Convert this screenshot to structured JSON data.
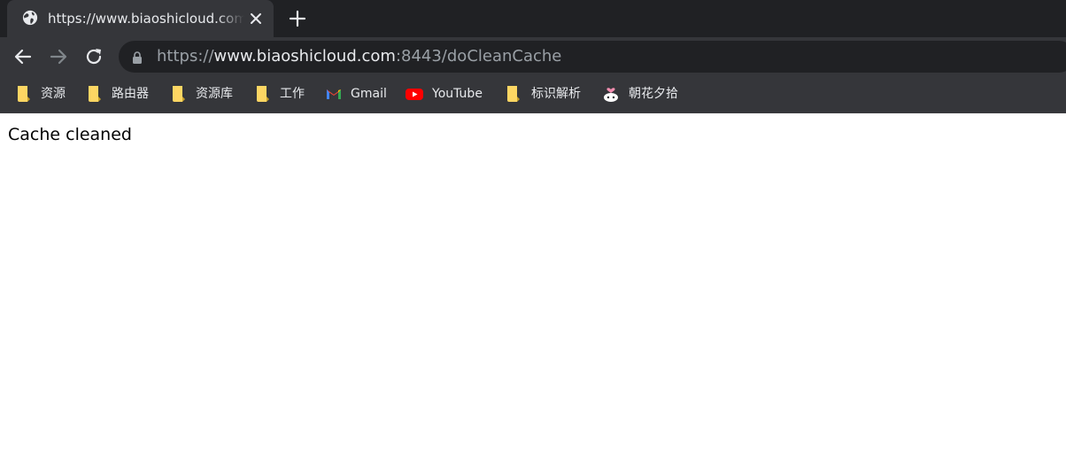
{
  "tab": {
    "title": "https://www.biaoshicloud.com/doCleanCache",
    "favicon_icon": "globe-icon",
    "close_icon": "close-icon"
  },
  "new_tab_icon": "plus-icon",
  "toolbar": {
    "back_icon": "arrow-left-icon",
    "forward_icon": "arrow-right-icon",
    "reload_icon": "reload-icon",
    "lock_icon": "lock-icon"
  },
  "address": {
    "scheme": "https://",
    "host": "www.biaoshicloud.com",
    "rest": ":8443/doCleanCache"
  },
  "bookmarks": [
    {
      "label": "资源",
      "icon": "folder-icon"
    },
    {
      "label": "路由器",
      "icon": "folder-icon"
    },
    {
      "label": "资源库",
      "icon": "folder-icon"
    },
    {
      "label": "工作",
      "icon": "folder-icon"
    },
    {
      "label": "Gmail",
      "icon": "gmail-icon"
    },
    {
      "label": "YouTube",
      "icon": "youtube-icon"
    },
    {
      "label": "标识解析",
      "icon": "folder-icon"
    },
    {
      "label": "朝花夕拾",
      "icon": "site-favicon-icon"
    }
  ],
  "page": {
    "message": "Cache cleaned"
  },
  "colors": {
    "tabstrip": "#202124",
    "toolbar": "#35363a",
    "text_light": "#e8eaed",
    "text_dim": "#9aa0a6",
    "folder": "#fdd663",
    "youtube_red": "#ff0000"
  }
}
